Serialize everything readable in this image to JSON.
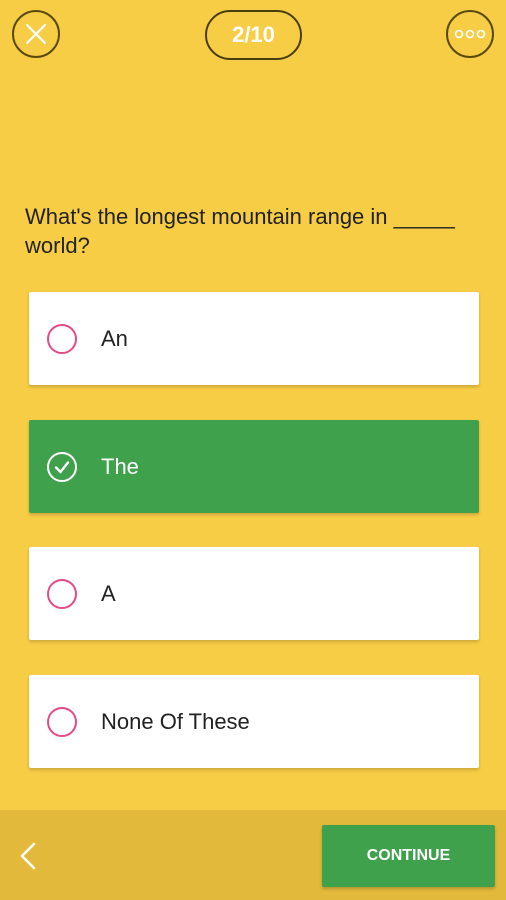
{
  "header": {
    "counter": "2/10",
    "close_icon": "close-icon",
    "more_icon": "more-options-icon"
  },
  "question": {
    "text": "What's the longest mountain range in _____ world?"
  },
  "options": [
    {
      "label": "An",
      "selected": false
    },
    {
      "label": "The",
      "selected": true
    },
    {
      "label": "A",
      "selected": false
    },
    {
      "label": "None Of These",
      "selected": false
    }
  ],
  "footer": {
    "continue_label": "CONTINUE",
    "back_icon": "chevron-left-icon"
  },
  "colors": {
    "background": "#f7cd46",
    "selected": "#3fa14b",
    "radio": "#e64a86",
    "footer": "#e2b93a"
  }
}
